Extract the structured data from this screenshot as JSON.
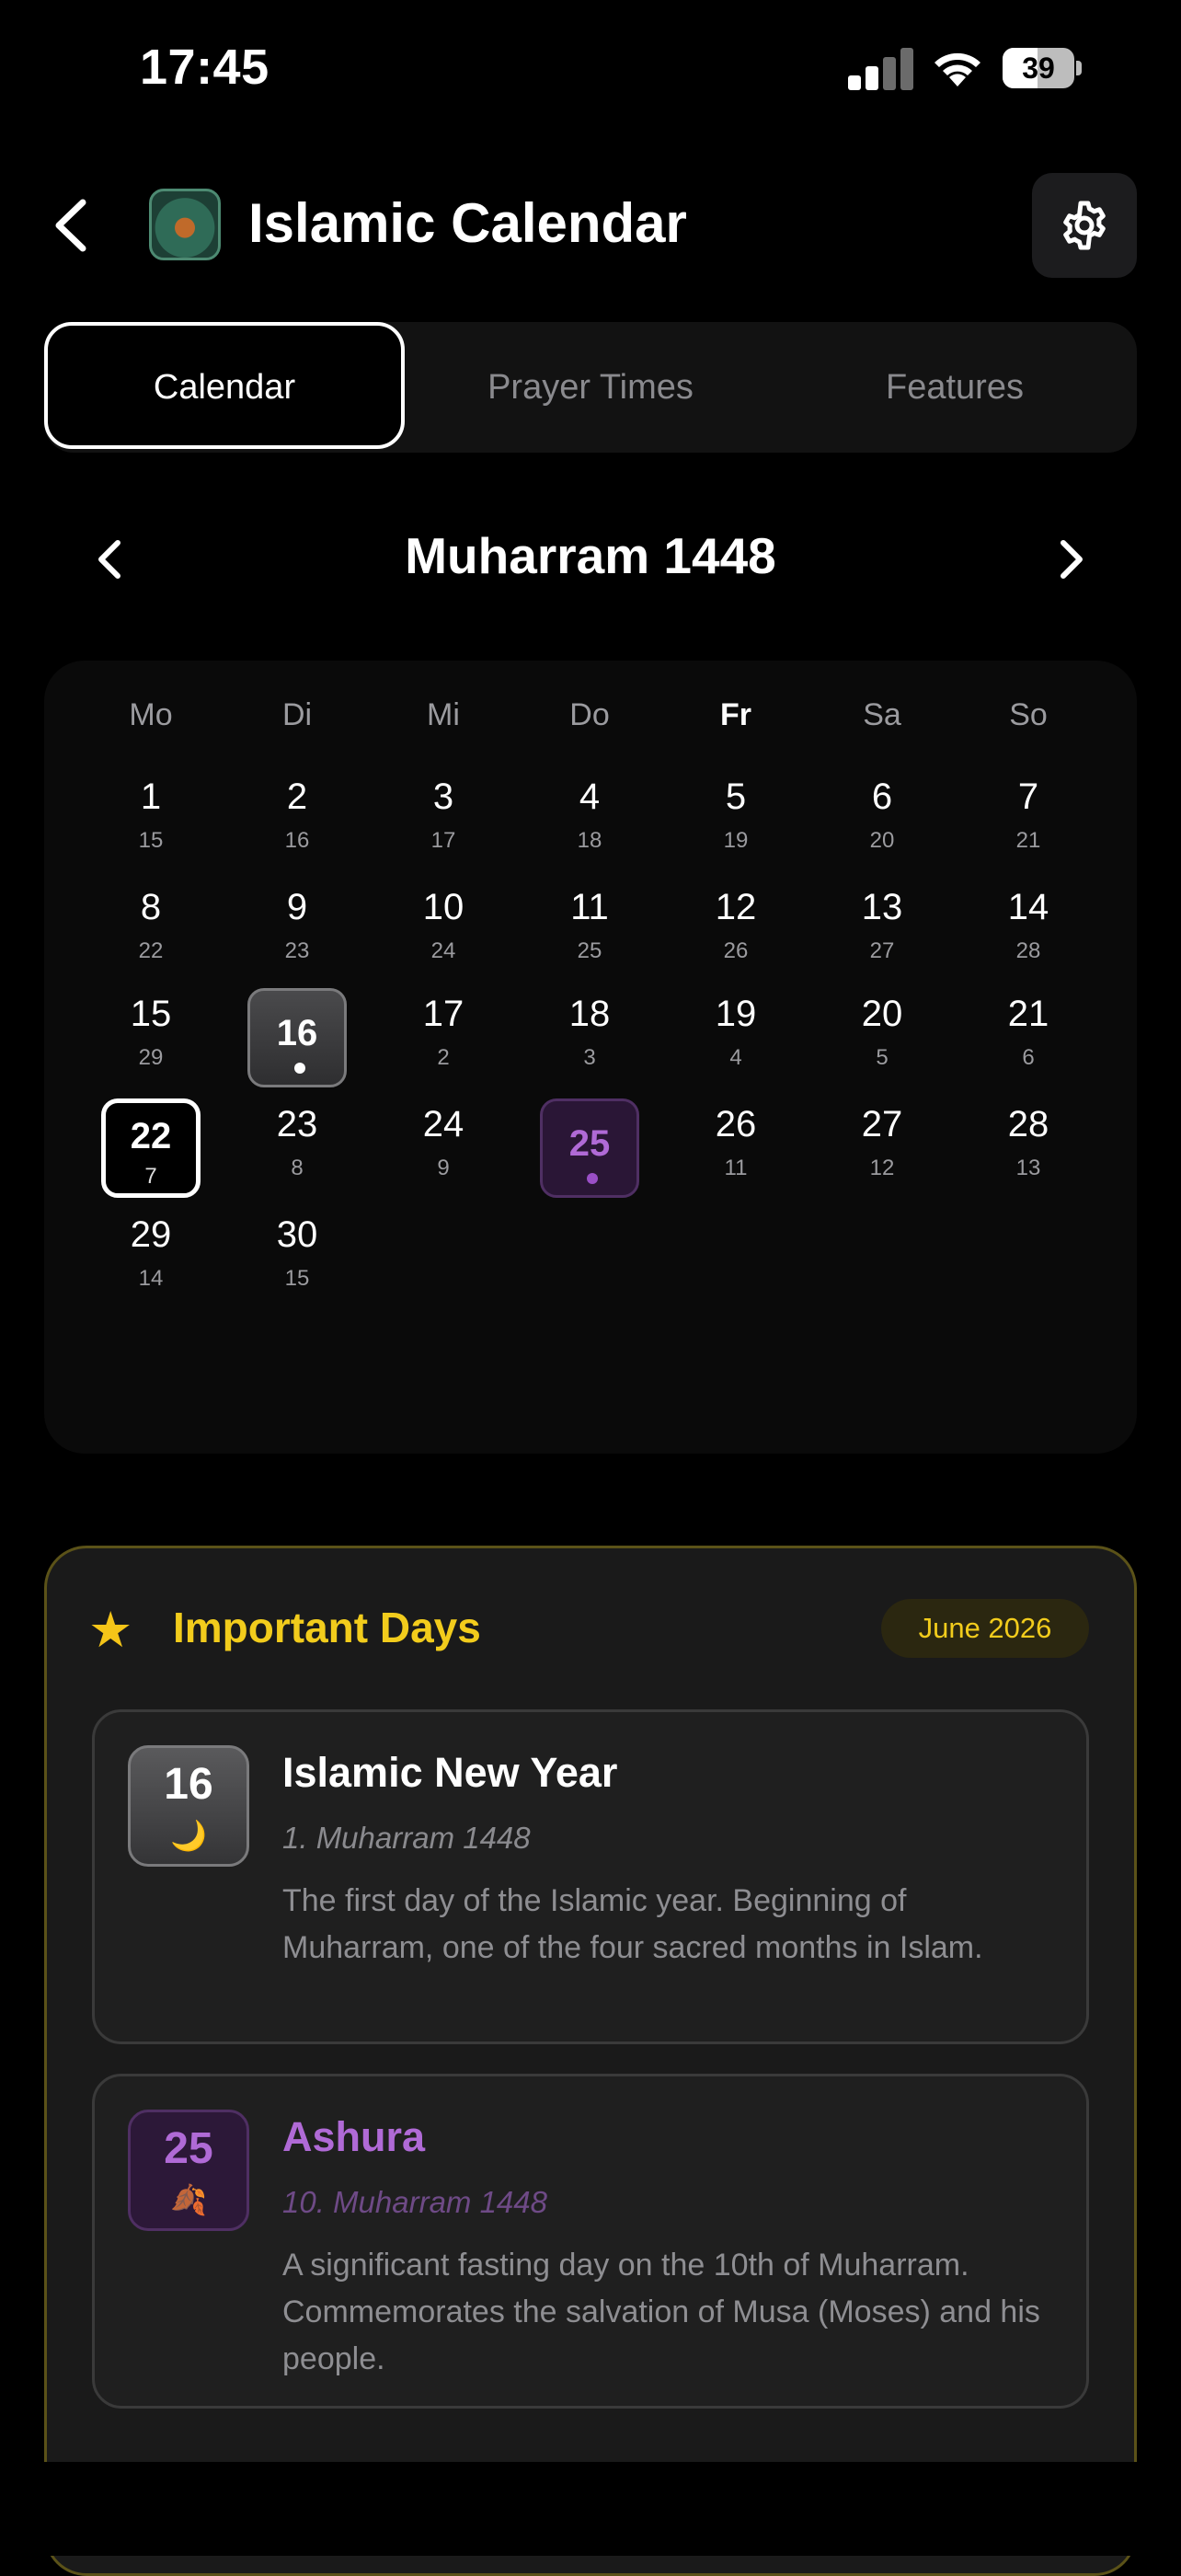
{
  "status_bar": {
    "time": "17:45",
    "battery": "39"
  },
  "header": {
    "title": "Islamic Calendar",
    "icons": {
      "back": "chevron-left-icon",
      "settings": "gear-icon",
      "app": "app-logo"
    }
  },
  "tabs": [
    {
      "label": "Calendar",
      "active": true
    },
    {
      "label": "Prayer Times",
      "active": false
    },
    {
      "label": "Features",
      "active": false
    }
  ],
  "calendar": {
    "month_title": "Muharram 1448",
    "weekdays": [
      "Mo",
      "Di",
      "Mi",
      "Do",
      "Fr",
      "Sa",
      "So"
    ],
    "days": [
      {
        "d": "1",
        "g": "15"
      },
      {
        "d": "2",
        "g": "16"
      },
      {
        "d": "3",
        "g": "17"
      },
      {
        "d": "4",
        "g": "18"
      },
      {
        "d": "5",
        "g": "19"
      },
      {
        "d": "6",
        "g": "20"
      },
      {
        "d": "7",
        "g": "21"
      },
      {
        "d": "8",
        "g": "22"
      },
      {
        "d": "9",
        "g": "23"
      },
      {
        "d": "10",
        "g": "24"
      },
      {
        "d": "11",
        "g": "25"
      },
      {
        "d": "12",
        "g": "26"
      },
      {
        "d": "13",
        "g": "27"
      },
      {
        "d": "14",
        "g": "28"
      },
      {
        "d": "15",
        "g": "29"
      },
      {
        "d": "16",
        "g": "",
        "style": "hl16"
      },
      {
        "d": "17",
        "g": "2"
      },
      {
        "d": "18",
        "g": "3"
      },
      {
        "d": "19",
        "g": "4"
      },
      {
        "d": "20",
        "g": "5"
      },
      {
        "d": "21",
        "g": "6"
      },
      {
        "d": "22",
        "g": "7",
        "style": "today"
      },
      {
        "d": "23",
        "g": "8"
      },
      {
        "d": "24",
        "g": "9"
      },
      {
        "d": "25",
        "g": "",
        "style": "hl25"
      },
      {
        "d": "26",
        "g": "11"
      },
      {
        "d": "27",
        "g": "12"
      },
      {
        "d": "28",
        "g": "13"
      },
      {
        "d": "29",
        "g": "14"
      },
      {
        "d": "30",
        "g": "15"
      }
    ]
  },
  "important_days": {
    "title": "Important Days",
    "badge": "June 2026",
    "icon": "star-icon",
    "events": [
      {
        "day": "16",
        "icon": "🌙",
        "name": "Islamic New Year",
        "hijri_date": "1. Muharram 1448",
        "description": "The first day of the Islamic year. Beginning of Muharram, one of the four sacred months in Islam."
      },
      {
        "day": "25",
        "icon": "🍂",
        "name": "Ashura",
        "hijri_date": "10. Muharram 1448",
        "description": "A significant fasting day on the 10th of Muharram. Commemorates the salvation of Musa (Moses) and his people."
      }
    ]
  },
  "colors": {
    "accent_gold": "#f2cc1c",
    "accent_purple": "#b06ad6",
    "background": "#000000"
  }
}
